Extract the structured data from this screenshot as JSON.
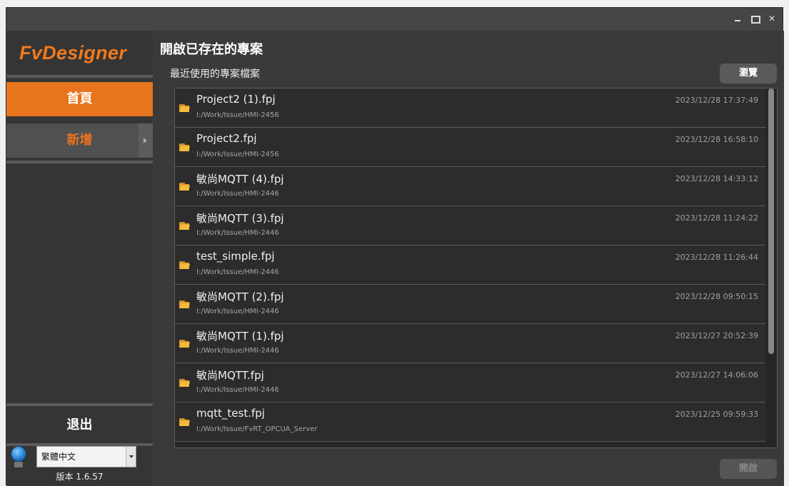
{
  "window": {
    "controls": {
      "minimize": "–",
      "maximize": "▫",
      "close": "✕"
    }
  },
  "sidebar": {
    "logo": "FvDesigner",
    "nav_home": "首頁",
    "nav_new": "新增",
    "exit": "退出",
    "language": {
      "selected": "繁體中文"
    },
    "version": "版本 1.6.57"
  },
  "main": {
    "title": "開啟已存在的專案",
    "section_label": "最近使用的專案檔案",
    "browse_label": "瀏覽",
    "open_label": "開啟",
    "recent_projects": [
      {
        "name": "Project2 (1).fpj",
        "path": "I:/Work/Issue/HMI-2456",
        "time": "2023/12/28 17:37:49"
      },
      {
        "name": "Project2.fpj",
        "path": "I:/Work/Issue/HMI-2456",
        "time": "2023/12/28 16:58:10"
      },
      {
        "name": "敏尚MQTT (4).fpj",
        "path": "I:/Work/Issue/HMI-2446",
        "time": "2023/12/28 14:33:12"
      },
      {
        "name": "敏尚MQTT (3).fpj",
        "path": "I:/Work/Issue/HMI-2446",
        "time": "2023/12/28 11:24:22"
      },
      {
        "name": "test_simple.fpj",
        "path": "I:/Work/Issue/HMI-2446",
        "time": "2023/12/28 11:26:44"
      },
      {
        "name": "敏尚MQTT (2).fpj",
        "path": "I:/Work/Issue/HMI-2446",
        "time": "2023/12/28 09:50:15"
      },
      {
        "name": "敏尚MQTT (1).fpj",
        "path": "I:/Work/Issue/HMI-2446",
        "time": "2023/12/27 20:52:39"
      },
      {
        "name": "敏尚MQTT.fpj",
        "path": "I:/Work/Issue/HMI-2446",
        "time": "2023/12/27 14:06:06"
      },
      {
        "name": "mqtt_test.fpj",
        "path": "I:/Work/Issue/FvRT_OPCUA_Server",
        "time": "2023/12/25 09:59:33"
      }
    ]
  },
  "icons": {
    "folder": "folder-icon",
    "globe": "globe-icon",
    "submenu": "chevron-right-icon",
    "dropdown": "chevron-down-icon"
  },
  "colors": {
    "accent": "#e8741e",
    "background": "#3a3a3a",
    "list_background": "#2c2c2c"
  }
}
